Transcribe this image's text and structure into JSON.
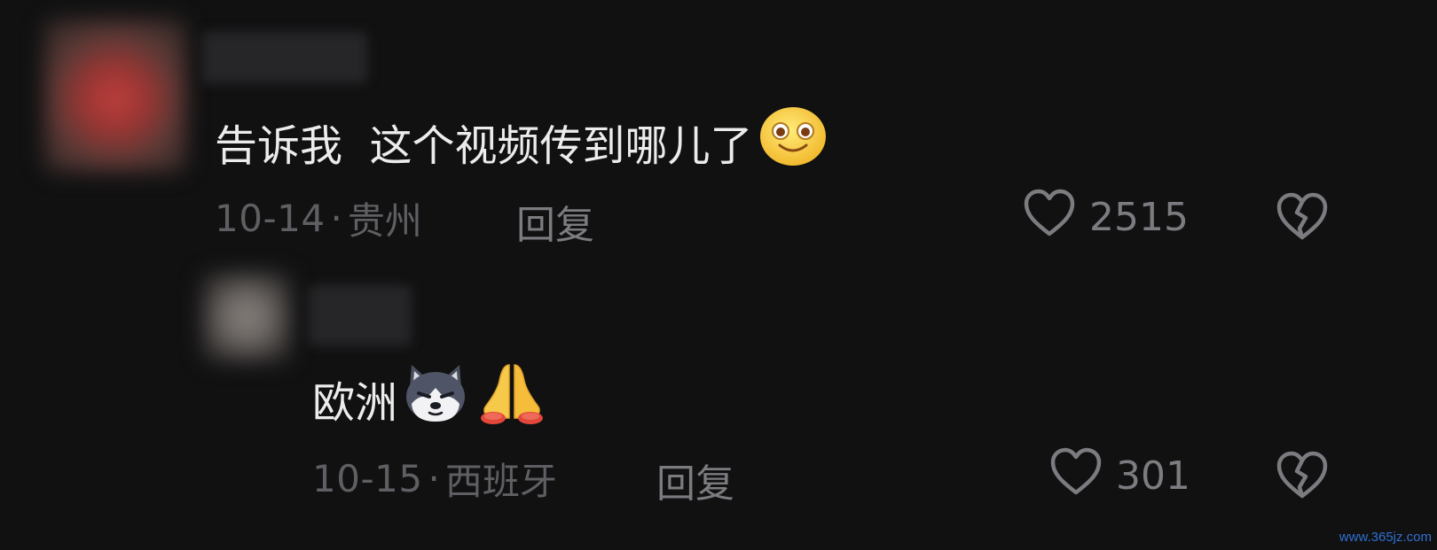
{
  "comments": [
    {
      "text": "告诉我  这个视频传到哪儿了",
      "emoji": [
        "smile-emoji"
      ],
      "date": "10-14",
      "location": "贵州",
      "reply_label": "回复",
      "likes": "2515"
    },
    {
      "text": "欧洲",
      "emoji": [
        "husky-dog-emoji",
        "praying-hands-emoji"
      ],
      "date": "10-15",
      "location": "西班牙",
      "reply_label": "回复",
      "likes": "301"
    }
  ],
  "meta_separator": "·",
  "icons": {
    "like": "heart-outline-icon",
    "dislike": "broken-heart-icon"
  },
  "colors": {
    "background": "#111112",
    "text": "#ececec",
    "meta": "#5f5f63",
    "action": "#7c7c80"
  },
  "watermark": "www.365jz.com"
}
